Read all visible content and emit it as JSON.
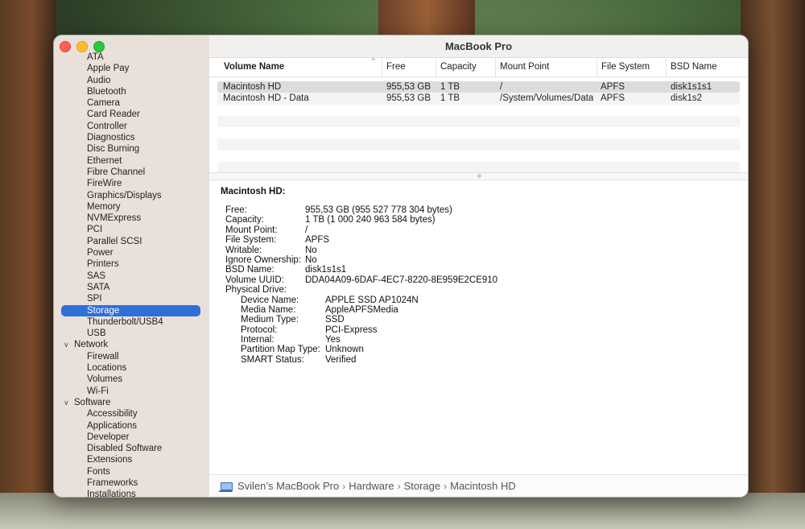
{
  "window": {
    "title": "MacBook Pro"
  },
  "sidebar": {
    "items": [
      {
        "label": "ATA",
        "group": false
      },
      {
        "label": "Apple Pay",
        "group": false
      },
      {
        "label": "Audio",
        "group": false
      },
      {
        "label": "Bluetooth",
        "group": false
      },
      {
        "label": "Camera",
        "group": false
      },
      {
        "label": "Card Reader",
        "group": false
      },
      {
        "label": "Controller",
        "group": false
      },
      {
        "label": "Diagnostics",
        "group": false
      },
      {
        "label": "Disc Burning",
        "group": false
      },
      {
        "label": "Ethernet",
        "group": false
      },
      {
        "label": "Fibre Channel",
        "group": false
      },
      {
        "label": "FireWire",
        "group": false
      },
      {
        "label": "Graphics/Displays",
        "group": false
      },
      {
        "label": "Memory",
        "group": false
      },
      {
        "label": "NVMExpress",
        "group": false
      },
      {
        "label": "PCI",
        "group": false
      },
      {
        "label": "Parallel SCSI",
        "group": false
      },
      {
        "label": "Power",
        "group": false
      },
      {
        "label": "Printers",
        "group": false
      },
      {
        "label": "SAS",
        "group": false
      },
      {
        "label": "SATA",
        "group": false
      },
      {
        "label": "SPI",
        "group": false
      },
      {
        "label": "Storage",
        "group": false,
        "selected": true
      },
      {
        "label": "Thunderbolt/USB4",
        "group": false
      },
      {
        "label": "USB",
        "group": false
      },
      {
        "label": "Network",
        "group": true
      },
      {
        "label": "Firewall",
        "group": false
      },
      {
        "label": "Locations",
        "group": false
      },
      {
        "label": "Volumes",
        "group": false
      },
      {
        "label": "Wi-Fi",
        "group": false
      },
      {
        "label": "Software",
        "group": true
      },
      {
        "label": "Accessibility",
        "group": false
      },
      {
        "label": "Applications",
        "group": false
      },
      {
        "label": "Developer",
        "group": false
      },
      {
        "label": "Disabled Software",
        "group": false
      },
      {
        "label": "Extensions",
        "group": false
      },
      {
        "label": "Fonts",
        "group": false
      },
      {
        "label": "Frameworks",
        "group": false
      },
      {
        "label": "Installations",
        "group": false
      }
    ]
  },
  "table": {
    "columns": [
      "Volume Name",
      "Free",
      "Capacity",
      "Mount Point",
      "File System",
      "BSD Name"
    ],
    "rows": [
      [
        "Macintosh HD",
        "955,53 GB",
        "1 TB",
        "/",
        "APFS",
        "disk1s1s1"
      ],
      [
        "Macintosh HD - Data",
        "955,53 GB",
        "1 TB",
        "/System/Volumes/Data",
        "APFS",
        "disk1s2"
      ]
    ]
  },
  "details": {
    "title": "Macintosh HD:",
    "fields": [
      {
        "k": "Free:",
        "v": "955,53 GB (955 527 778 304 bytes)"
      },
      {
        "k": "Capacity:",
        "v": "1 TB (1 000 240 963 584 bytes)"
      },
      {
        "k": "Mount Point:",
        "v": "/"
      },
      {
        "k": "File System:",
        "v": "APFS"
      },
      {
        "k": "Writable:",
        "v": "No"
      },
      {
        "k": "Ignore Ownership:",
        "v": "No"
      },
      {
        "k": "BSD Name:",
        "v": "disk1s1s1"
      },
      {
        "k": "Volume UUID:",
        "v": "DDA04A09-6DAF-4EC7-8220-8E959E2CE910"
      },
      {
        "k": "Physical Drive:",
        "v": ""
      }
    ],
    "physical_drive": [
      {
        "k": "Device Name:",
        "v": "APPLE SSD AP1024N"
      },
      {
        "k": "Media Name:",
        "v": "AppleAPFSMedia"
      },
      {
        "k": "Medium Type:",
        "v": "SSD"
      },
      {
        "k": "Protocol:",
        "v": "PCI-Express"
      },
      {
        "k": "Internal:",
        "v": "Yes"
      },
      {
        "k": "Partition Map Type:",
        "v": "Unknown"
      },
      {
        "k": "SMART Status:",
        "v": "Verified"
      }
    ]
  },
  "breadcrumb": [
    "Svilen’s MacBook Pro",
    "Hardware",
    "Storage",
    "Macintosh HD"
  ],
  "colors": {
    "selection": "#2f6fd8",
    "close": "#fe5f57",
    "minimize": "#febc2e",
    "zoom": "#28c840"
  },
  "icons": {
    "breadcrumb": "laptop-icon",
    "sort": "chevron-up-icon",
    "group": "chevron-down-icon"
  }
}
